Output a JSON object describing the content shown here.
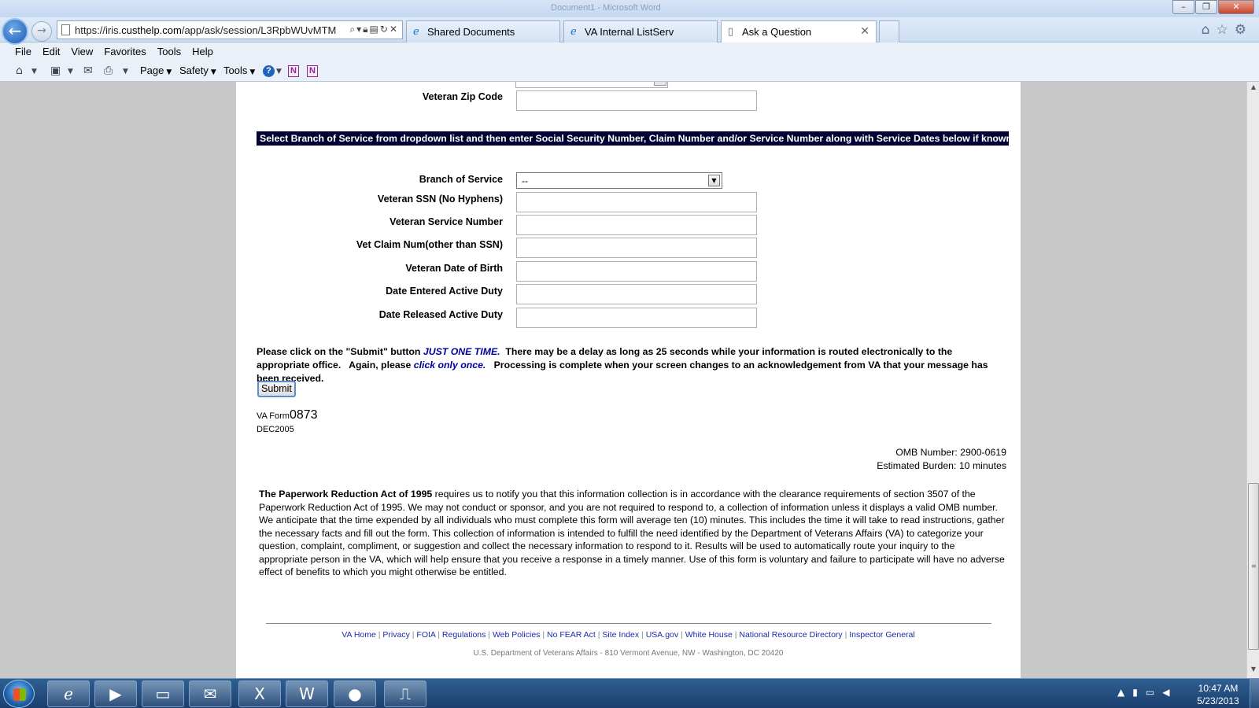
{
  "browser": {
    "window_title": "Document1 - Microsoft Word",
    "address_url_prefix": "https://iris.",
    "address_url_domain": "custhelp.com",
    "address_url_rest": "/app/ask/session/L3RpbWUvMTM",
    "tabs": [
      {
        "label": "Shared Documents",
        "icon": "ie-icon"
      },
      {
        "label": "VA Internal ListServ",
        "icon": "ie-icon"
      },
      {
        "label": "Ask a Question",
        "icon": "page-icon"
      }
    ],
    "menu": [
      "File",
      "Edit",
      "View",
      "Favorites",
      "Tools",
      "Help"
    ],
    "command_bar": [
      "Page",
      "Safety",
      "Tools"
    ]
  },
  "form": {
    "zip_label": "Veteran Zip Code",
    "banner": "Select Branch of Service from dropdown list and then enter Social Security Number, Claim Number and/or Service Number along with Service Dates below if known.",
    "branch_label": "Branch of Service",
    "branch_value": "--",
    "fields": [
      {
        "label": "Veteran SSN (No Hyphens)",
        "value": ""
      },
      {
        "label": "Veteran Service Number",
        "value": ""
      },
      {
        "label": "Vet Claim Num(other than SSN)",
        "value": ""
      },
      {
        "label": "Veteran Date of Birth",
        "value": ""
      },
      {
        "label": "Date Entered Active Duty",
        "value": ""
      },
      {
        "label": "Date Released Active Duty",
        "value": ""
      }
    ],
    "instr_1": "Please click on the \"Submit\" button ",
    "instr_em1": "JUST ONE TIME.",
    "instr_2": "  There may be a delay as long as 25 seconds while your information is routed electronically to the appropriate office.   Again, please ",
    "instr_em2": "click only once.",
    "instr_3": "   Processing is complete when your screen changes to an acknowledgement from VA that your message has been received.",
    "submit_label": "Submit",
    "form_prefix": "VA Form",
    "form_number": "0873",
    "form_date": "DEC2005",
    "omb_number": "OMB Number: 2900-0619",
    "burden": "Estimated Burden: 10 minutes",
    "pra_title": "The Paperwork Reduction Act of 1995",
    "pra_body": " requires us to notify you that this information collection is in accordance with the clearance requirements of section 3507 of the Paperwork Reduction Act of 1995. We may not conduct or sponsor, and you are not required to respond to, a collection of information unless it displays a valid OMB number. We anticipate that the time expended by all individuals who must complete this form will average ten (10) minutes. This includes the time it will take to read instructions, gather the necessary facts and fill out the form. This collection of information is intended to fulfill the need identified by the Department of Veterans Affairs (VA) to categorize your question, complaint, compliment, or suggestion and collect the necessary information to respond to it. Results will be used to automatically route your inquiry to the appropriate person in the VA, which will help ensure that you receive a response in a timely manner. Use of this form is voluntary and failure to participate will have no adverse effect of benefits to which you might otherwise be entitled."
  },
  "footer": {
    "links": [
      "VA Home",
      "Privacy",
      "FOIA",
      "Regulations",
      "Web Policies",
      "No FEAR Act",
      "Site Index",
      "USA.gov",
      "White House",
      "National Resource Directory",
      "Inspector General"
    ],
    "address": "U.S. Department of Veterans Affairs - 810 Vermont Avenue, NW - Washington, DC 20420"
  },
  "taskbar": {
    "apps": [
      "internet-explorer-icon",
      "media-player-icon",
      "file-explorer-icon",
      "outlook-icon",
      "excel-icon",
      "word-icon",
      "messenger-icon",
      "pdf-reader-icon"
    ],
    "time": "10:47 AM",
    "date": "5/23/2013"
  }
}
